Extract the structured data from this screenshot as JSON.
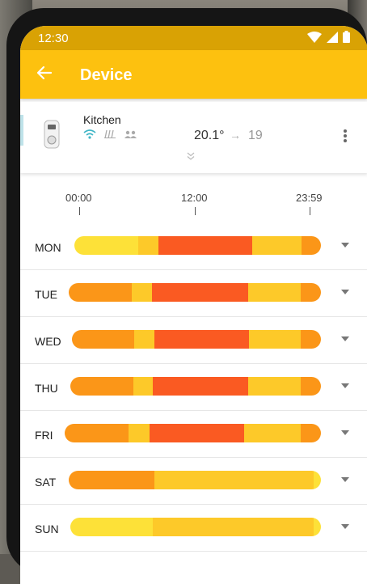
{
  "statusbar": {
    "time": "12:30"
  },
  "appbar": {
    "title": "Device"
  },
  "device": {
    "name": "Kitchen",
    "current_temp": "20.1°",
    "arrow": "→",
    "target_temp": "19"
  },
  "timeline": {
    "labels": [
      "00:00",
      "12:00",
      "23:59"
    ]
  },
  "colors": {
    "light_yellow": "#fde138",
    "yellow": "#fdc929",
    "orange": "#fb9618",
    "red_orange": "#fa5a22",
    "appbar": "#fdc10f"
  },
  "schedule": [
    {
      "day": "MON",
      "segments": [
        [
          "light_yellow",
          0.26
        ],
        [
          "yellow",
          0.08
        ],
        [
          "red_orange",
          0.38
        ],
        [
          "yellow",
          0.2
        ],
        [
          "orange",
          0.08
        ]
      ]
    },
    {
      "day": "TUE",
      "segments": [
        [
          "orange",
          0.25
        ],
        [
          "yellow",
          0.08
        ],
        [
          "red_orange",
          0.38
        ],
        [
          "yellow",
          0.21
        ],
        [
          "orange",
          0.08
        ]
      ]
    },
    {
      "day": "WED",
      "segments": [
        [
          "orange",
          0.25
        ],
        [
          "yellow",
          0.08
        ],
        [
          "red_orange",
          0.38
        ],
        [
          "yellow",
          0.21
        ],
        [
          "orange",
          0.08
        ]
      ]
    },
    {
      "day": "THU",
      "segments": [
        [
          "orange",
          0.25
        ],
        [
          "yellow",
          0.08
        ],
        [
          "red_orange",
          0.38
        ],
        [
          "yellow",
          0.21
        ],
        [
          "orange",
          0.08
        ]
      ]
    },
    {
      "day": "FRI",
      "segments": [
        [
          "orange",
          0.25
        ],
        [
          "yellow",
          0.08
        ],
        [
          "red_orange",
          0.37
        ],
        [
          "yellow",
          0.22
        ],
        [
          "orange",
          0.08
        ]
      ]
    },
    {
      "day": "SAT",
      "segments": [
        [
          "orange",
          0.34
        ],
        [
          "yellow",
          0.63
        ],
        [
          "light_yellow",
          0.03
        ]
      ]
    },
    {
      "day": "SUN",
      "segments": [
        [
          "light_yellow",
          0.33
        ],
        [
          "yellow",
          0.64
        ],
        [
          "light_yellow",
          0.03
        ]
      ]
    }
  ]
}
